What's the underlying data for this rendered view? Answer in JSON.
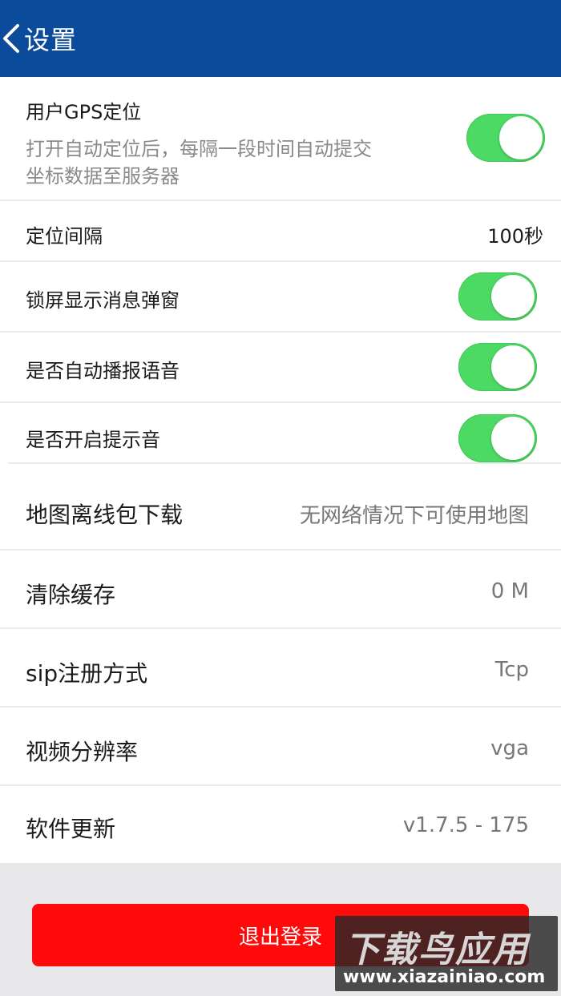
{
  "header": {
    "title": "设置",
    "back_icon": "chevron-left-icon",
    "background": "#0b4b9b"
  },
  "settings": {
    "gps": {
      "label": "用户GPS定位",
      "desc_line1": "打开自动定位后，每隔一段时间自动提交",
      "desc_line2": "坐标数据至服务器",
      "enabled": true
    },
    "interval": {
      "label": "定位间隔",
      "value": "100秒"
    },
    "lockscreen_popup": {
      "label": "锁屏显示消息弹窗",
      "enabled": true
    },
    "auto_voice": {
      "label": "是否自动播报语音",
      "enabled": true
    },
    "prompt_tone": {
      "label": "是否开启提示音",
      "enabled": true
    },
    "offline_map": {
      "label": "地图离线包下载",
      "value": "无网络情况下可使用地图"
    },
    "clear_cache": {
      "label": "清除缓存",
      "value": "0 M"
    },
    "sip_mode": {
      "label": "sip注册方式",
      "value": "Tcp"
    },
    "video_resolution": {
      "label": "视频分辨率",
      "value": "vga"
    },
    "software_update": {
      "label": "软件更新",
      "value": "v1.7.5 - 175"
    }
  },
  "logout": {
    "label": "退出登录",
    "color": "#ff0a0a"
  },
  "toggle_color": "#4cd964",
  "watermark": {
    "top": "下载鸟应用",
    "bottom": "www.xiazainiao.com"
  }
}
